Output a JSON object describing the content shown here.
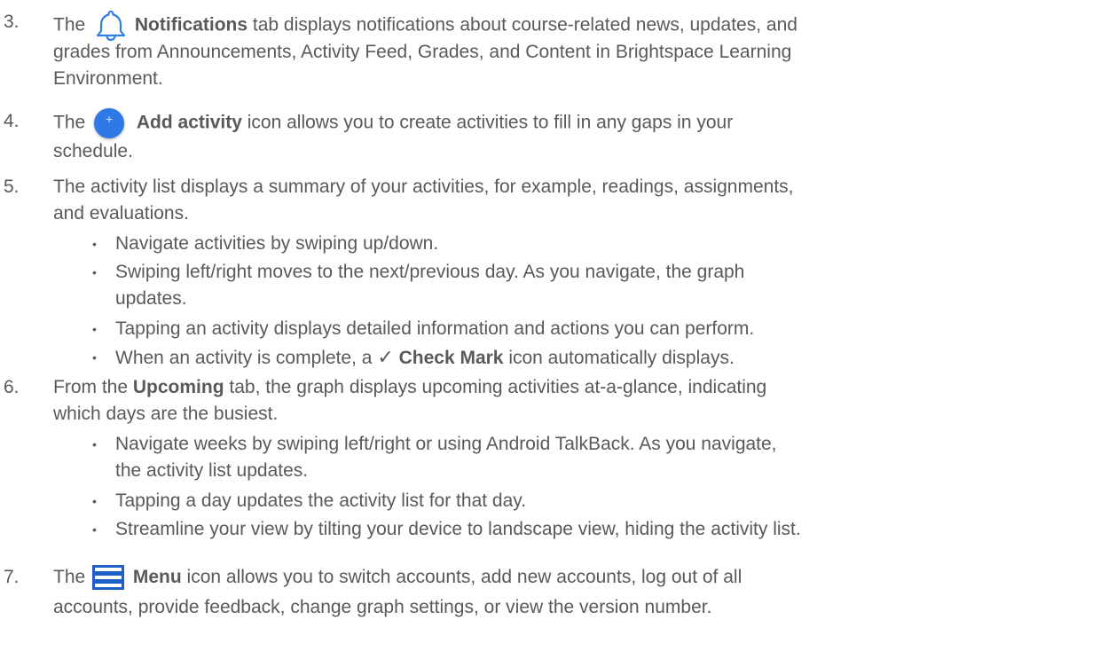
{
  "items": [
    {
      "number": "3.",
      "lines": [
        {
          "before": "The",
          "icon": "bell-icon",
          "bold": "Notifications",
          "after": "tab displays notifications about course-related news, updates, and"
        },
        {
          "text": "grades from Announcements, Activity Feed, Grades, and Content in Brightspace Learning"
        },
        {
          "text": "Environment."
        }
      ]
    },
    {
      "number": "4.",
      "lines": [
        {
          "before": "The",
          "icon": "add-activity-icon",
          "icon_glyph": "+",
          "bold": "Add activity",
          "after": "icon allows you to create activities to fill in any gaps in your"
        },
        {
          "text": "schedule."
        }
      ]
    },
    {
      "number": "5.",
      "lines": [
        {
          "text": "The activity list displays a summary of your activities, for example, readings, assignments,"
        },
        {
          "text": "and evaluations."
        }
      ],
      "bullets": [
        {
          "lines": [
            "Navigate activities by swiping up/down."
          ]
        },
        {
          "lines": [
            "Swiping left/right moves to the next/previous day. As you navigate, the graph",
            "updates."
          ]
        },
        {
          "lines": [
            "Tapping an activity displays detailed information and actions you can perform."
          ]
        },
        {
          "before": "When an activity is complete, a",
          "icon": "check-mark-icon",
          "icon_glyph": "✓",
          "bold": "Check Mark",
          "after": "icon automatically displays."
        }
      ]
    },
    {
      "number": "6.",
      "lines": [
        {
          "before": "From the",
          "bold": "Upcoming",
          "after": "tab, the graph displays upcoming activities at-a-glance, indicating"
        },
        {
          "text": "which days are the busiest."
        }
      ],
      "bullets": [
        {
          "lines": [
            "Navigate weeks by swiping left/right or using Android TalkBack. As you navigate,",
            "the activity list updates."
          ]
        },
        {
          "lines": [
            "Tapping a day updates the activity list for that day."
          ]
        },
        {
          "lines": [
            "Streamline your view by tilting your device to landscape view, hiding the activity list."
          ]
        }
      ]
    },
    {
      "number": "7.",
      "lines": [
        {
          "before": "The",
          "icon": "menu-icon",
          "bold": "Menu",
          "after": "icon allows you to switch accounts, add new accounts, log out of all"
        },
        {
          "text": "accounts, provide feedback, change graph settings, or view the version number."
        }
      ]
    }
  ],
  "bullet_glyph": "•",
  "colors": {
    "text": "#595959",
    "bell_icon": "#2f7fe0",
    "add_button": "#2f79e6",
    "menu_icon": "#1e5fc8"
  }
}
